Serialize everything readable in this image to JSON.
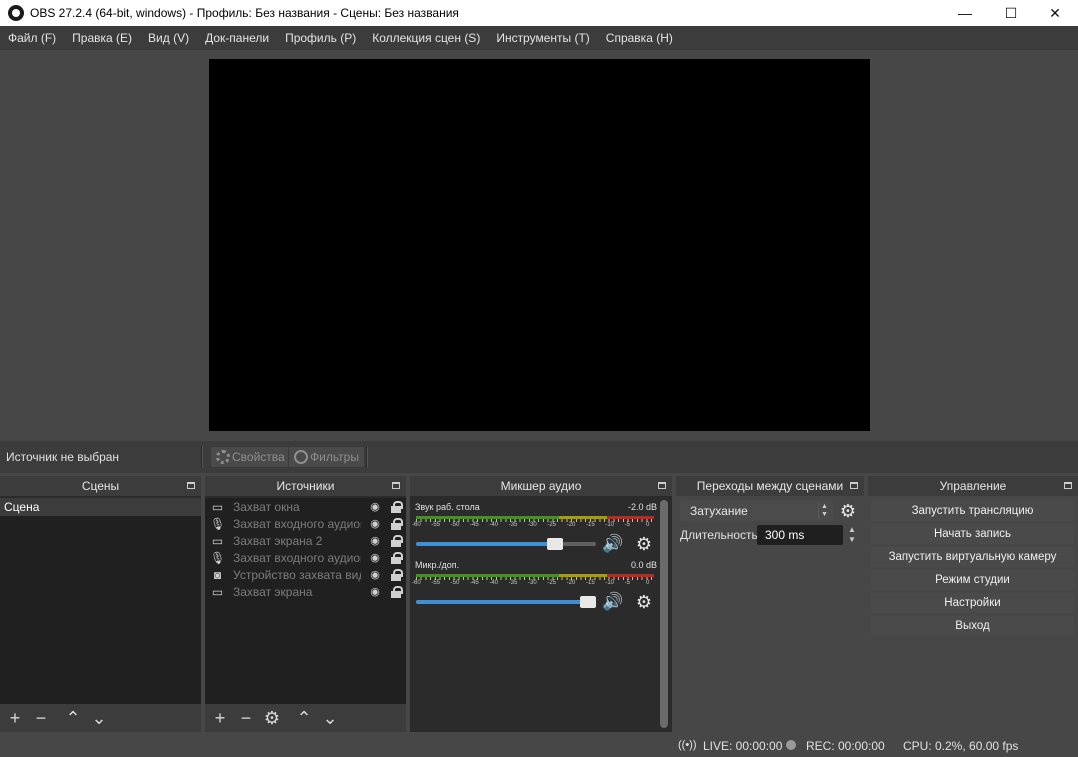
{
  "window": {
    "title": "OBS 27.2.4 (64-bit, windows) - Профиль: Без названия - Сцены: Без названия",
    "minimize": "—",
    "maximize": "☐",
    "close": "✕"
  },
  "menu": [
    "Файл (F)",
    "Правка (E)",
    "Вид (V)",
    "Док-панели",
    "Профиль (P)",
    "Коллекция сцен (S)",
    "Инструменты (T)",
    "Справка (H)"
  ],
  "source_bar": {
    "no_source": "Источник не выбран",
    "properties": "Свойства",
    "filters": "Фильтры"
  },
  "scenes": {
    "title": "Сцены",
    "items": [
      "Сцена"
    ]
  },
  "sources": {
    "title": "Источники",
    "items": [
      {
        "label": "Захват окна",
        "icon": "window-icon"
      },
      {
        "label": "Захват входного аудиопотока",
        "icon": "microphone-icon"
      },
      {
        "label": "Захват экрана 2",
        "icon": "monitor-icon"
      },
      {
        "label": "Захват входного аудиопотока",
        "icon": "microphone-icon"
      },
      {
        "label": "Устройство захвата видео",
        "icon": "camera-icon"
      },
      {
        "label": "Захват экрана",
        "icon": "monitor-icon"
      }
    ]
  },
  "mixer": {
    "title": "Микшер аудио",
    "scale": [
      "-60",
      "-55",
      "-50",
      "-45",
      "-40",
      "-35",
      "-30",
      "-25",
      "-20",
      "-15",
      "-10",
      "-5",
      "0"
    ],
    "channels": [
      {
        "name": "Звук раб. стола",
        "db": "-2.0 dB",
        "volume": 0.8
      },
      {
        "name": "Микр./доп.",
        "db": "0.0 dB",
        "volume": 1.0
      }
    ]
  },
  "transitions": {
    "title": "Переходы между сценами",
    "selected": "Затухание",
    "duration_label": "Длительность",
    "duration_value": "300 ms"
  },
  "controls": {
    "title": "Управление",
    "buttons": [
      "Запустить трансляцию",
      "Начать запись",
      "Запустить виртуальную камеру",
      "Режим студии",
      "Настройки",
      "Выход"
    ]
  },
  "status": {
    "live": "LIVE: 00:00:00",
    "rec": "REC: 00:00:00",
    "cpu": "CPU: 0.2%, 60.00 fps"
  }
}
